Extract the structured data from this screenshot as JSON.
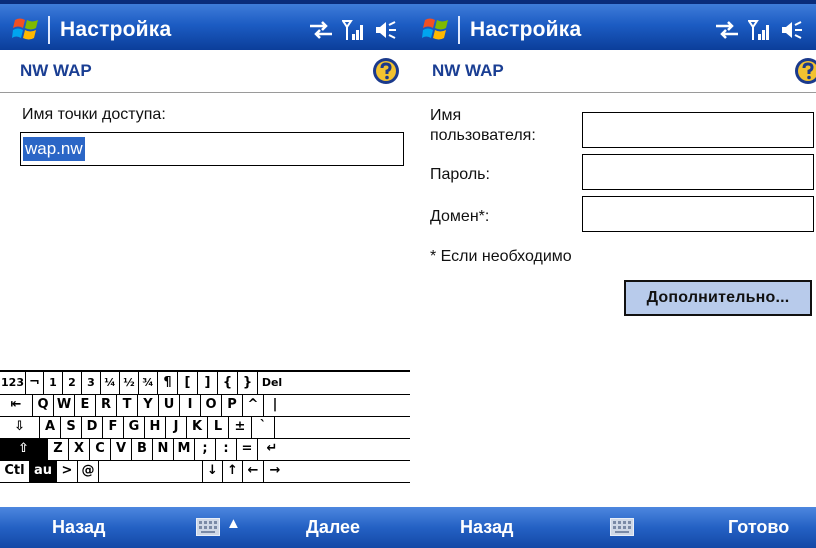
{
  "colors": {
    "title_bar": "#1c5cc3",
    "menu_bar": "#2461c4",
    "header_text": "#1a3e93",
    "selection": "#2b66c6",
    "button": "#b8cbeb"
  },
  "left_screen": {
    "title": "Настройка",
    "header": "NW WAP",
    "access_point_label": "Имя точки доступа:",
    "access_point_value": "wap.nw",
    "menu_left": "Назад",
    "menu_right": "Далее",
    "sip_arrow": "▲",
    "keyboard": {
      "row1": [
        "123",
        "¬",
        "1",
        "2",
        "3",
        "¼",
        "½",
        "¾",
        "¶",
        "[",
        "]",
        "{",
        "}",
        "Del"
      ],
      "row2": [
        "⇤",
        "Q",
        "W",
        "E",
        "R",
        "T",
        "Y",
        "U",
        "I",
        "O",
        "P",
        "^",
        "|"
      ],
      "row3": [
        "⇩",
        "A",
        "S",
        "D",
        "F",
        "G",
        "H",
        "J",
        "K",
        "L",
        "±",
        "`"
      ],
      "row4": [
        "⇧",
        "Z",
        "X",
        "C",
        "V",
        "B",
        "N",
        "M",
        ";",
        ":",
        "=",
        "↵"
      ],
      "row5": [
        "Ctl",
        "au",
        ">",
        "@",
        "",
        "↓",
        "↑",
        "←",
        "→"
      ]
    }
  },
  "right_screen": {
    "title": "Настройка",
    "header": "NW WAP",
    "username_label_1": "Имя",
    "username_label_2": "пользователя:",
    "password_label": "Пароль:",
    "domain_label": "Домен*:",
    "username_value": "",
    "password_value": "",
    "domain_value": "",
    "footnote": "* Если необходимо",
    "advanced_button": "Дополнительно...",
    "menu_left": "Назад",
    "menu_right": "Готово"
  },
  "icons": [
    "windows-flag-icon",
    "connectivity-icon",
    "signal-icon",
    "volume-icon",
    "help-icon",
    "keyboard-icon"
  ]
}
